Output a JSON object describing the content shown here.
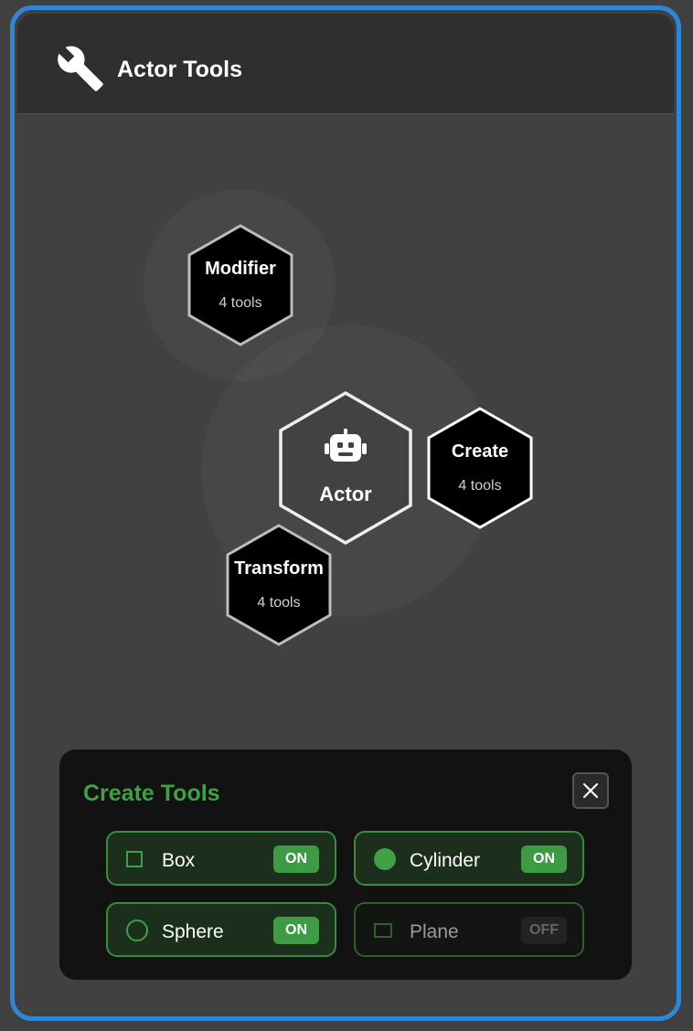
{
  "window": {
    "title": "Actor Tools",
    "accent_color": "#2f86d4"
  },
  "icons": {
    "header": "wrench-icon",
    "actor": "robot-icon",
    "close": "close-icon"
  },
  "radial_menu": {
    "center": {
      "label": "Actor"
    },
    "nodes": [
      {
        "id": "modifier",
        "label": "Modifier",
        "sub": "4 tools"
      },
      {
        "id": "create",
        "label": "Create",
        "sub": "4 tools"
      },
      {
        "id": "transform",
        "label": "Transform",
        "sub": "4 tools"
      }
    ]
  },
  "create_panel": {
    "title": "Create Tools",
    "title_color": "#3fa046",
    "tools": [
      {
        "label": "Box",
        "state": "ON",
        "icon": "square-outline-icon"
      },
      {
        "label": "Cylinder",
        "state": "ON",
        "icon": "circle-filled-icon"
      },
      {
        "label": "Sphere",
        "state": "ON",
        "icon": "circle-outline-icon"
      },
      {
        "label": "Plane",
        "state": "OFF",
        "icon": "rectangle-outline-icon"
      }
    ]
  }
}
